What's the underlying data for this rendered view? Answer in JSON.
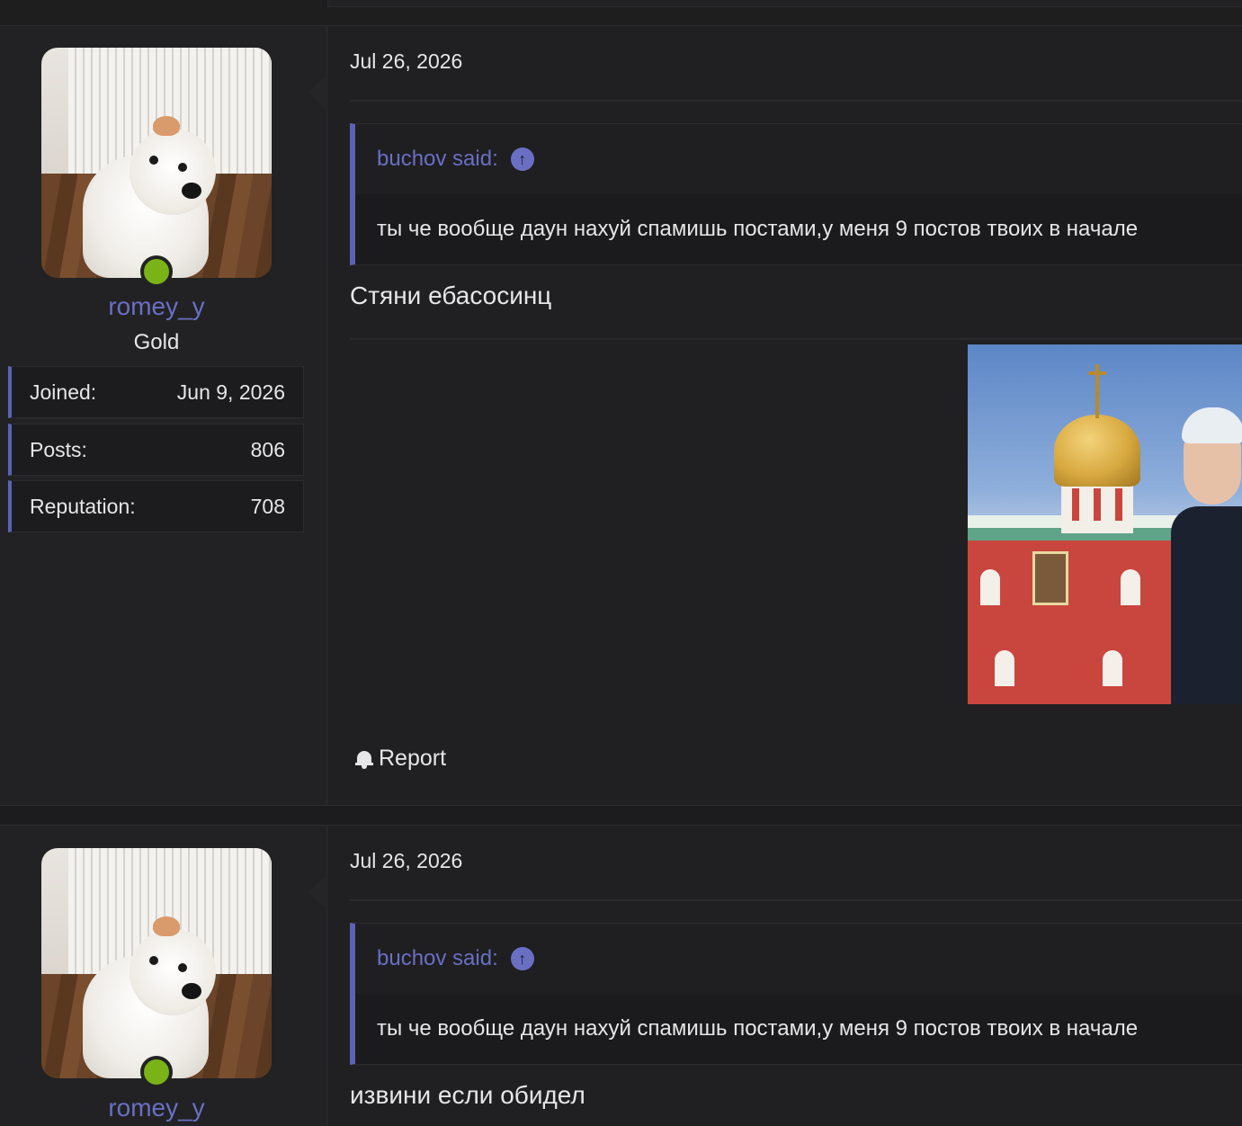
{
  "posts": [
    {
      "user": {
        "name": "romey_y",
        "title": "Gold"
      },
      "stats": [
        {
          "label": "Joined:",
          "value": "Jun 9, 2026"
        },
        {
          "label": "Posts:",
          "value": "806"
        },
        {
          "label": "Reputation:",
          "value": "708"
        }
      ],
      "date": "Jul 26, 2026",
      "quote": {
        "author": "buchov said:",
        "text": "ты че вообще даун нахуй спамишь постами,у меня 9 постов твоих в начале"
      },
      "text": "Стяни ебасосинц",
      "report_label": "Report"
    },
    {
      "user": {
        "name": "romey_y"
      },
      "date": "Jul 26, 2026",
      "quote": {
        "author": "buchov said:",
        "text": "ты че вообще даун нахуй спамишь постами,у меня 9 постов твоих в начале"
      },
      "text": "извини если обидел"
    }
  ],
  "colors": {
    "background": "#202022",
    "accent": "#5c62b3",
    "link": "#6a6fc4",
    "online": "#7ab317"
  },
  "icons": [
    "online-status-icon",
    "arrow-up-circle-icon",
    "bell-icon"
  ]
}
